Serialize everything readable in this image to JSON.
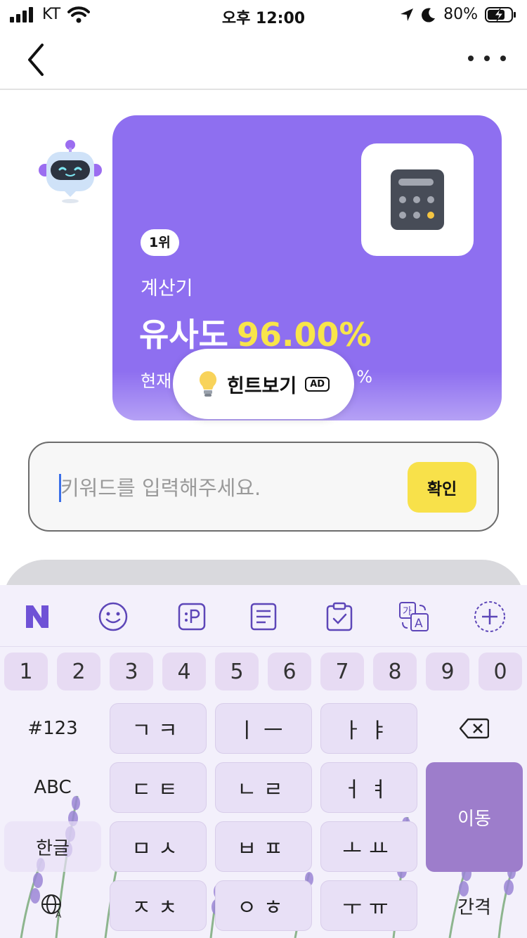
{
  "status_bar": {
    "carrier": "KT",
    "time": "오후 12:00",
    "battery": "80%"
  },
  "card": {
    "rank": "1위",
    "app_name": "계산기",
    "similarity_label": "유사도",
    "similarity_value": "96.00%",
    "current_label": "현재",
    "current_suffix": "%"
  },
  "hint": {
    "label": "힌트보기",
    "ad": "AD"
  },
  "search": {
    "placeholder": "키워드를 입력해주세요.",
    "value": "",
    "confirm_label": "확인"
  },
  "keyboard": {
    "numbers": [
      "1",
      "2",
      "3",
      "4",
      "5",
      "6",
      "7",
      "8",
      "9",
      "0"
    ],
    "rows": [
      {
        "func": "#123",
        "keys": [
          "ㄱㅋ",
          "ㅣㅡ",
          "ㅏㅑ"
        ]
      },
      {
        "func": "ABC",
        "keys": [
          "ㄷㅌ",
          "ㄴㄹ",
          "ㅓㅕ"
        ]
      },
      {
        "func": "한글",
        "keys": [
          "ㅁㅅ",
          "ㅂㅍ",
          "ㅗㅛ"
        ]
      },
      {
        "keys": [
          "ㅈㅊ",
          "ㅇㅎ",
          "ㅜㅠ"
        ]
      }
    ],
    "move_label": "이동",
    "space_label": "간격",
    "toolbar_icons": [
      "naver-n-icon",
      "emoji-icon",
      "sticker-icon",
      "memo-icon",
      "clipboard-icon",
      "translate-icon",
      "add-icon"
    ]
  }
}
